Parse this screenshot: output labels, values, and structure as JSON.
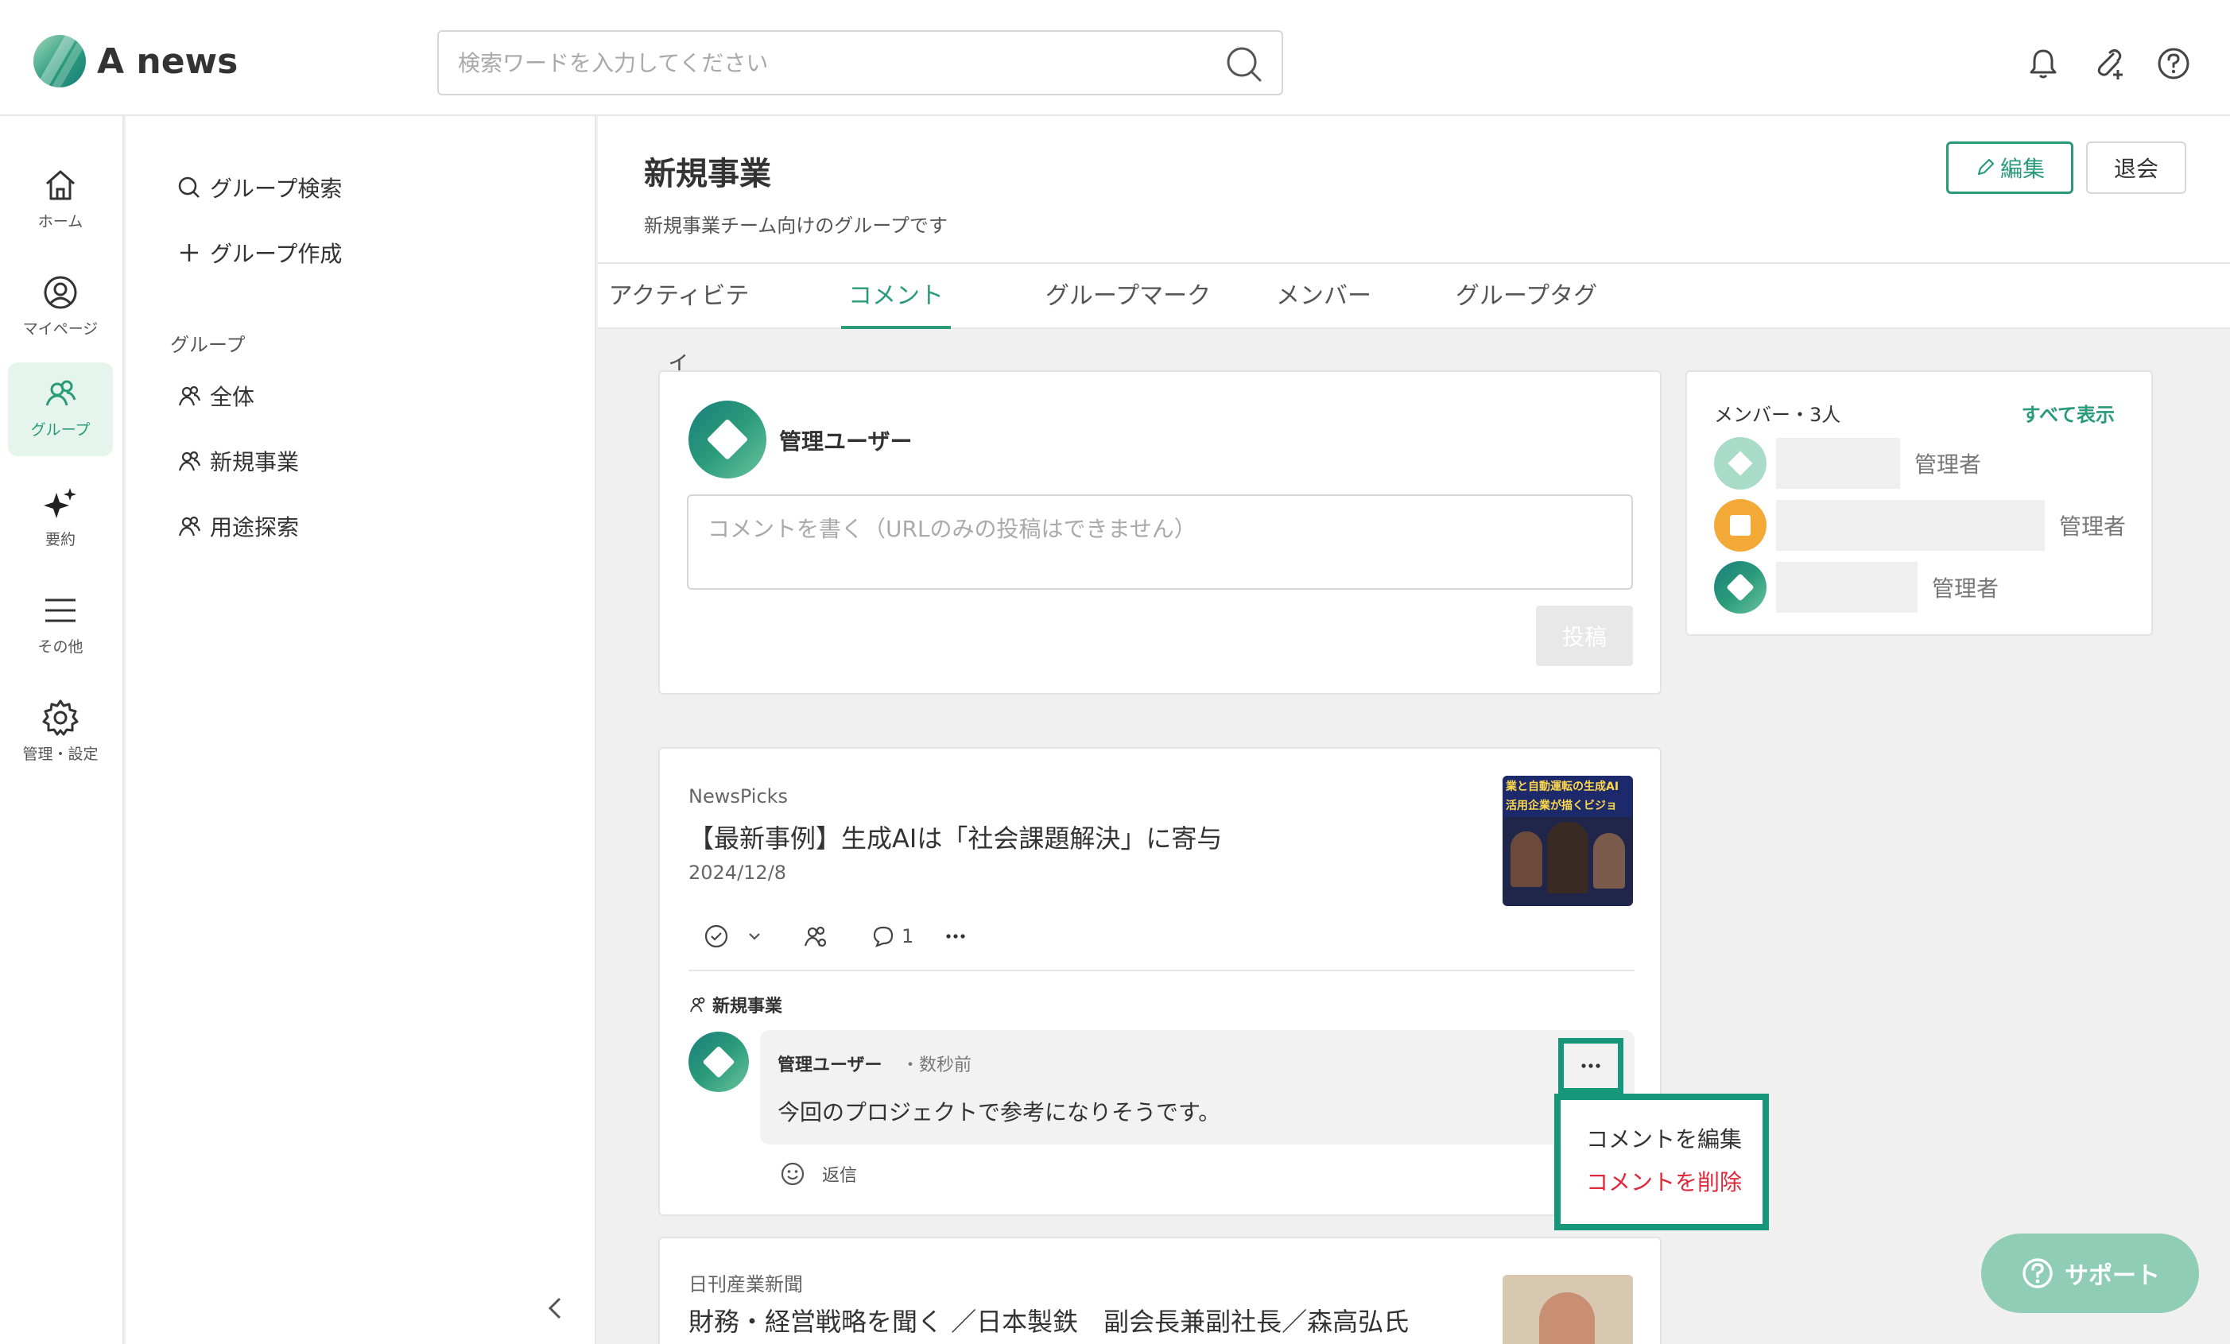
{
  "app": {
    "name": "A news"
  },
  "search": {
    "placeholder": "検索ワードを入力してください"
  },
  "rail": [
    {
      "label": "ホーム",
      "icon": "home-icon"
    },
    {
      "label": "マイページ",
      "icon": "user-icon"
    },
    {
      "label": "グループ",
      "icon": "group-icon"
    },
    {
      "label": "要約",
      "icon": "sparkle-icon"
    },
    {
      "label": "その他",
      "icon": "menu-icon"
    },
    {
      "label": "管理・設定",
      "icon": "gear-icon"
    }
  ],
  "sidebar": {
    "search_label": "グループ検索",
    "create_label": "グループ作成",
    "heading": "グループ",
    "groups": [
      "全体",
      "新規事業",
      "用途探索"
    ]
  },
  "group": {
    "title": "新規事業",
    "description": "新規事業チーム向けのグループです",
    "edit_label": "編集",
    "leave_label": "退会",
    "tabs": [
      "アクティビティ",
      "コメント",
      "グループマーク",
      "メンバー",
      "グループタグ"
    ],
    "active_tab": "コメント"
  },
  "composer": {
    "user": "管理ユーザー",
    "placeholder": "コメントを書く（URLのみの投稿はできません）",
    "post_label": "投稿"
  },
  "article1": {
    "source": "NewsPicks",
    "title": "【最新事例】生成AIは「社会課題解決」に寄与",
    "date": "2024/12/8",
    "comment_count": "1",
    "group_label": "新規事業",
    "comment": {
      "author": "管理ユーザー",
      "time": "・数秒前",
      "body": "今回のプロジェクトで参考になりそうです。",
      "reply_label": "返信"
    },
    "thumb_caption": "業と自動運転の生成AI活用企業が描くビジョ"
  },
  "comment_menu": {
    "edit_label": "コメントを編集",
    "delete_label": "コメントを削除"
  },
  "article2": {
    "source": "日刊産業新聞",
    "title": "財務・経営戦略を聞く ／日本製鉄　副会長兼副社長／森高弘氏"
  },
  "members": {
    "title": "メンバー・3人",
    "show_all": "すべて表示",
    "list": [
      {
        "role": "管理者"
      },
      {
        "role": "管理者"
      },
      {
        "role": "管理者"
      }
    ]
  },
  "support": {
    "label": "サポート"
  },
  "colors": {
    "accent": "#2a9b79",
    "danger": "#e0283c",
    "highlight": "#16977a"
  }
}
